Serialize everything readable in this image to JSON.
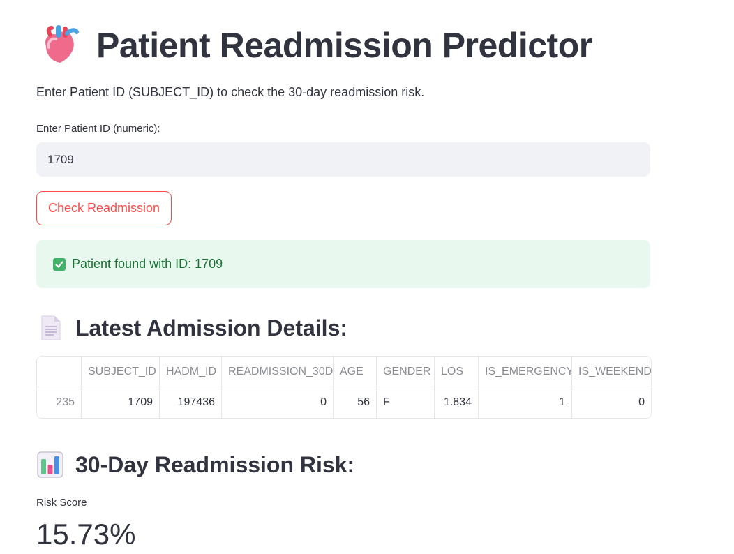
{
  "header": {
    "title": "Patient Readmission Predictor",
    "title_icon": "anatomical-heart-icon",
    "intro": "Enter Patient ID (SUBJECT_ID) to check the 30-day readmission risk."
  },
  "input": {
    "label": "Enter Patient ID (numeric):",
    "value": "1709"
  },
  "button": {
    "label": "Check Readmission",
    "color": "#ff4b4b"
  },
  "alert": {
    "icon": "check-mark-button-icon",
    "text": "Patient found with ID: 1709",
    "bg": "#e9f8ee",
    "color": "#177233"
  },
  "details": {
    "icon": "page-facing-up-icon",
    "heading": "Latest Admission Details:",
    "columns": [
      "",
      "SUBJECT_ID",
      "HADM_ID",
      "READMISSION_30D",
      "AGE",
      "GENDER",
      "LOS",
      "IS_EMERGENCY",
      "IS_WEEKEND"
    ],
    "rows": [
      [
        "235",
        "1709",
        "197436",
        "0",
        "56",
        "F",
        "1.834",
        "1",
        "0"
      ]
    ]
  },
  "risk": {
    "icon": "bar-chart-icon",
    "heading": "30-Day Readmission Risk:",
    "metric_label": "Risk Score",
    "metric_value": "15.73%"
  }
}
